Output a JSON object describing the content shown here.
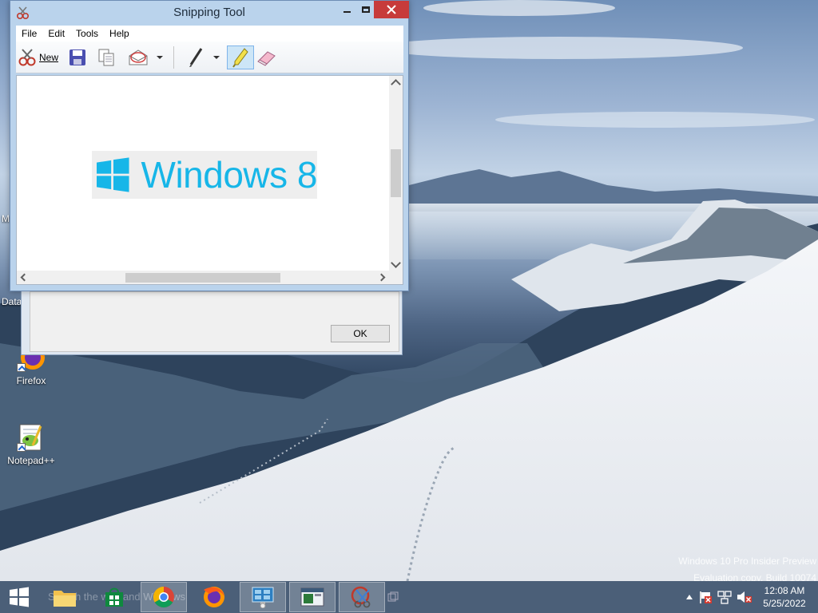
{
  "desktop": {
    "icons": [
      {
        "label": "Firefox"
      },
      {
        "label": "Notepad++"
      }
    ],
    "edge_labels": [
      "Data",
      "M"
    ]
  },
  "background_dialog": {
    "ok_label": "OK"
  },
  "snipping_tool": {
    "title": "Snipping Tool",
    "menu": [
      "File",
      "Edit",
      "Tools",
      "Help"
    ],
    "toolbar": {
      "new_label": "New"
    },
    "snip_text": "Windows 8"
  },
  "watermark": {
    "line1": "Windows 10 Pro Insider Preview",
    "line2": "Evaluation copy. Build 10074"
  },
  "taskbar": {
    "search_ghost": "Search the web and Windows",
    "clock_time": "12:08 AM",
    "clock_date": "5/25/2022"
  },
  "colors": {
    "taskbar": "#4b5f78",
    "close_button": "#c73b3b",
    "windows_blue": "#17b6e8"
  }
}
